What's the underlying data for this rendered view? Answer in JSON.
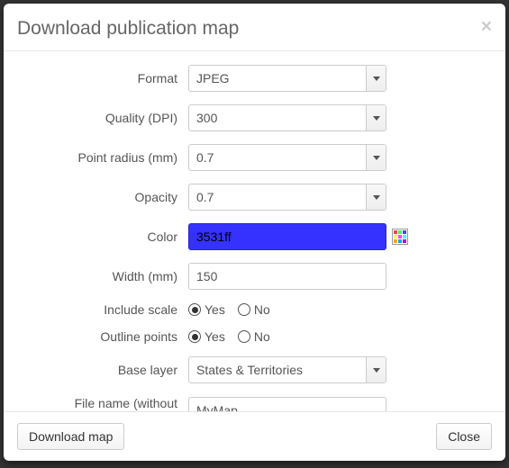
{
  "title": "Download publication map",
  "labels": {
    "format": "Format",
    "quality": "Quality (DPI)",
    "point_radius": "Point radius (mm)",
    "opacity": "Opacity",
    "color": "Color",
    "width": "Width (mm)",
    "include_scale": "Include scale",
    "outline_points": "Outline points",
    "base_layer": "Base layer",
    "file_name": "File name (without extension)"
  },
  "values": {
    "format": "JPEG",
    "quality": "300",
    "point_radius": "0.7",
    "opacity": "0.7",
    "color": "3531ff",
    "color_hex": "#3531ff",
    "width": "150",
    "include_scale": "yes",
    "outline_points": "yes",
    "base_layer": "States & Territories",
    "file_name": "MyMap"
  },
  "radio_options": {
    "yes": "Yes",
    "no": "No"
  },
  "buttons": {
    "download": "Download map",
    "close": "Close"
  }
}
